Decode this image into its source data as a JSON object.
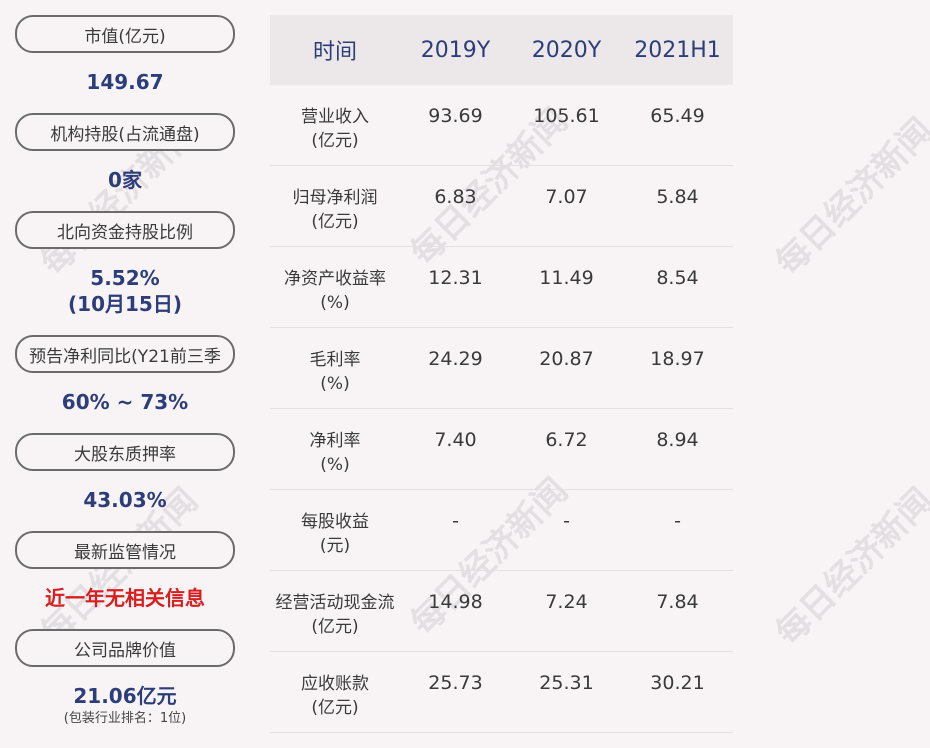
{
  "left_panel": [
    {
      "label": "市值(亿元)",
      "value": "149.67"
    },
    {
      "label": "机构持股(占流通盘)",
      "value": "0家"
    },
    {
      "label": "北向资金持股比例",
      "value": "5.52%",
      "value2": "(10月15日)"
    },
    {
      "label": "预告净利同比(Y21前三季",
      "value": "60% ~ 73%"
    },
    {
      "label": "大股东质押率",
      "value": "43.03%"
    },
    {
      "label": "最新监管情况",
      "value": "近一年无相关信息"
    },
    {
      "label": "公司品牌价值",
      "value": "21.06亿元",
      "note": "(包装行业排名：1位)"
    }
  ],
  "table": {
    "headers": [
      "时间",
      "2019Y",
      "2020Y",
      "2021H1"
    ],
    "rows": [
      {
        "name": "营业收入",
        "unit": "(亿元)",
        "values": [
          "93.69",
          "105.61",
          "65.49"
        ]
      },
      {
        "name": "归母净利润",
        "unit": "(亿元)",
        "values": [
          "6.83",
          "7.07",
          "5.84"
        ]
      },
      {
        "name": "净资产收益率",
        "unit": "(%)",
        "values": [
          "12.31",
          "11.49",
          "8.54"
        ]
      },
      {
        "name": "毛利率",
        "unit": "(%)",
        "values": [
          "24.29",
          "20.87",
          "18.97"
        ]
      },
      {
        "name": "净利率",
        "unit": "(%)",
        "values": [
          "7.40",
          "6.72",
          "8.94"
        ]
      },
      {
        "name": "每股收益",
        "unit": "(元)",
        "values": [
          "-",
          "-",
          "-"
        ]
      },
      {
        "name": "经营活动现金流",
        "unit": "(亿元)",
        "values": [
          "14.98",
          "7.24",
          "7.84"
        ]
      },
      {
        "name": "应收账款",
        "unit": "(亿元)",
        "values": [
          "25.73",
          "25.31",
          "30.21"
        ]
      }
    ]
  },
  "watermark": "每日经济新闻",
  "colors": {
    "value_blue": "#2c3e7a",
    "alert_red": "#d81e1e",
    "header_bg": "#ece8ea"
  }
}
